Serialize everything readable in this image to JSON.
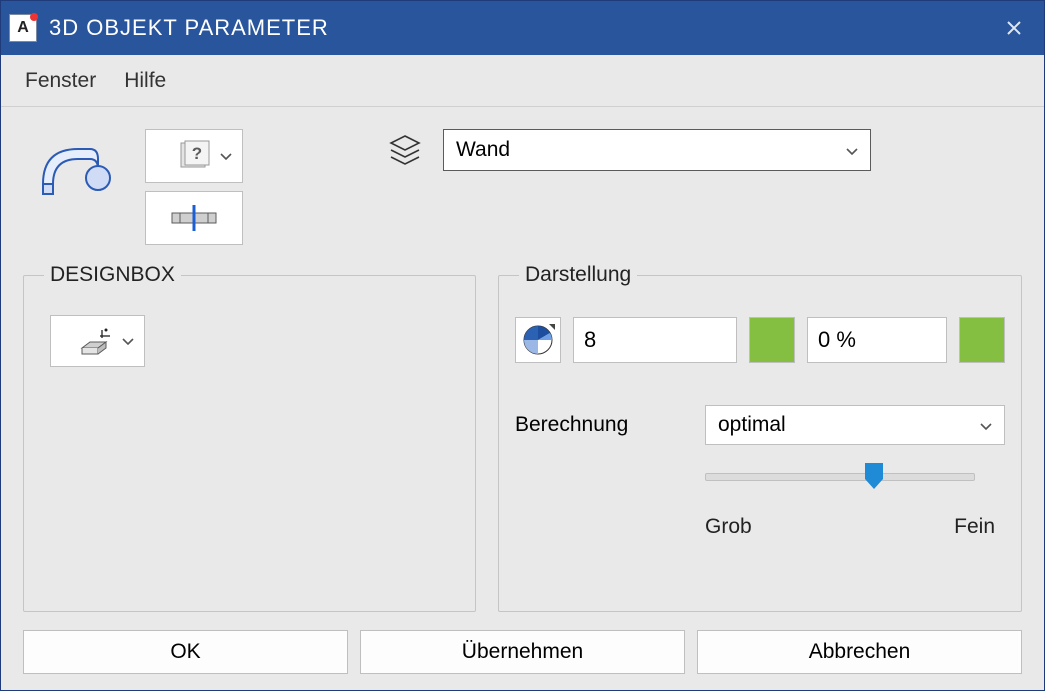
{
  "titlebar": {
    "app_icon_letter": "A",
    "title": "3D OBJEKT PARAMETER"
  },
  "menubar": {
    "items": [
      "Fenster",
      "Hilfe"
    ]
  },
  "layer": {
    "selected": "Wand"
  },
  "groups": {
    "designbox_title": "DESIGNBOX",
    "darstellung_title": "Darstellung"
  },
  "darstellung": {
    "color_value": "8",
    "percent_value": "0 %",
    "swatch_color": "#84bf41",
    "berechnung_label": "Berechnung",
    "berechnung_value": "optimal",
    "slider_coarse": "Grob",
    "slider_fine": "Fein"
  },
  "footer": {
    "ok": "OK",
    "apply": "Übernehmen",
    "cancel": "Abbrechen"
  }
}
